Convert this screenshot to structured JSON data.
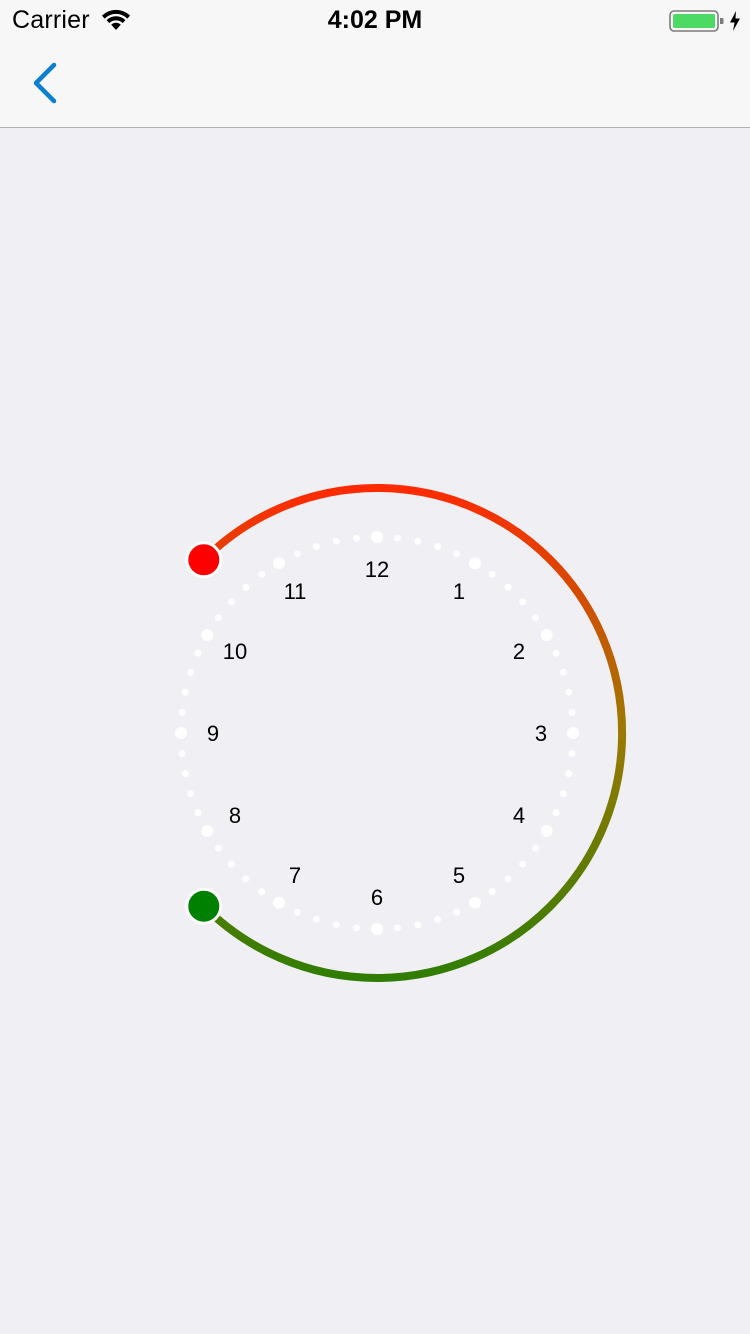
{
  "status_bar": {
    "carrier": "Carrier",
    "time": "4:02 PM",
    "wifi_icon": "wifi-icon",
    "battery_icon": "battery-icon",
    "charging_icon": "bolt-icon",
    "battery_color": "#4cd964"
  },
  "nav_bar": {
    "back_icon": "chevron-left-icon",
    "accent_color": "#0b7fd1"
  },
  "clock": {
    "hour_labels": [
      "12",
      "1",
      "2",
      "3",
      "4",
      "5",
      "6",
      "7",
      "8",
      "9",
      "10",
      "11"
    ],
    "start_handle": {
      "hour": 10.5,
      "color": "#ff0000"
    },
    "end_handle": {
      "hour": 7.5,
      "color": "#008000"
    },
    "arc_gradient": [
      "#ff2a00",
      "#9b7a00",
      "#2f7d00"
    ],
    "tick_color": "#ffffff"
  }
}
